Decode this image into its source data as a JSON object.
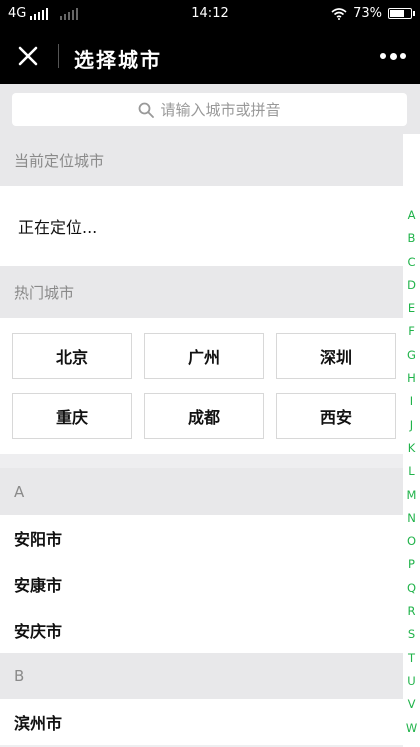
{
  "status_bar": {
    "network": "4G",
    "time": "14:12",
    "battery": "73%",
    "battery_level": 0.73
  },
  "navbar": {
    "title": "选择城市",
    "close_icon": "close-icon",
    "more_icon": "more-icon"
  },
  "search": {
    "placeholder": "请输入城市或拼音",
    "icon": "search-icon"
  },
  "sections": {
    "current_header": "当前定位城市",
    "current_status": "正在定位...",
    "hot_header": "热门城市",
    "hot_cities": [
      "北京",
      "广州",
      "深圳",
      "重庆",
      "成都",
      "西安"
    ]
  },
  "groups": [
    {
      "letter": "A",
      "cities": [
        "安阳市",
        "安康市",
        "安庆市"
      ]
    },
    {
      "letter": "B",
      "cities": [
        "滨州市"
      ]
    }
  ],
  "index_letters": [
    "A",
    "B",
    "C",
    "D",
    "E",
    "F",
    "G",
    "H",
    "I",
    "J",
    "K",
    "L",
    "M",
    "N",
    "O",
    "P",
    "Q",
    "R",
    "S",
    "T",
    "U",
    "V",
    "W"
  ],
  "colors": {
    "accent": "#20b34a",
    "header_bg": "#000000",
    "section_bg": "#e8e8ea"
  }
}
